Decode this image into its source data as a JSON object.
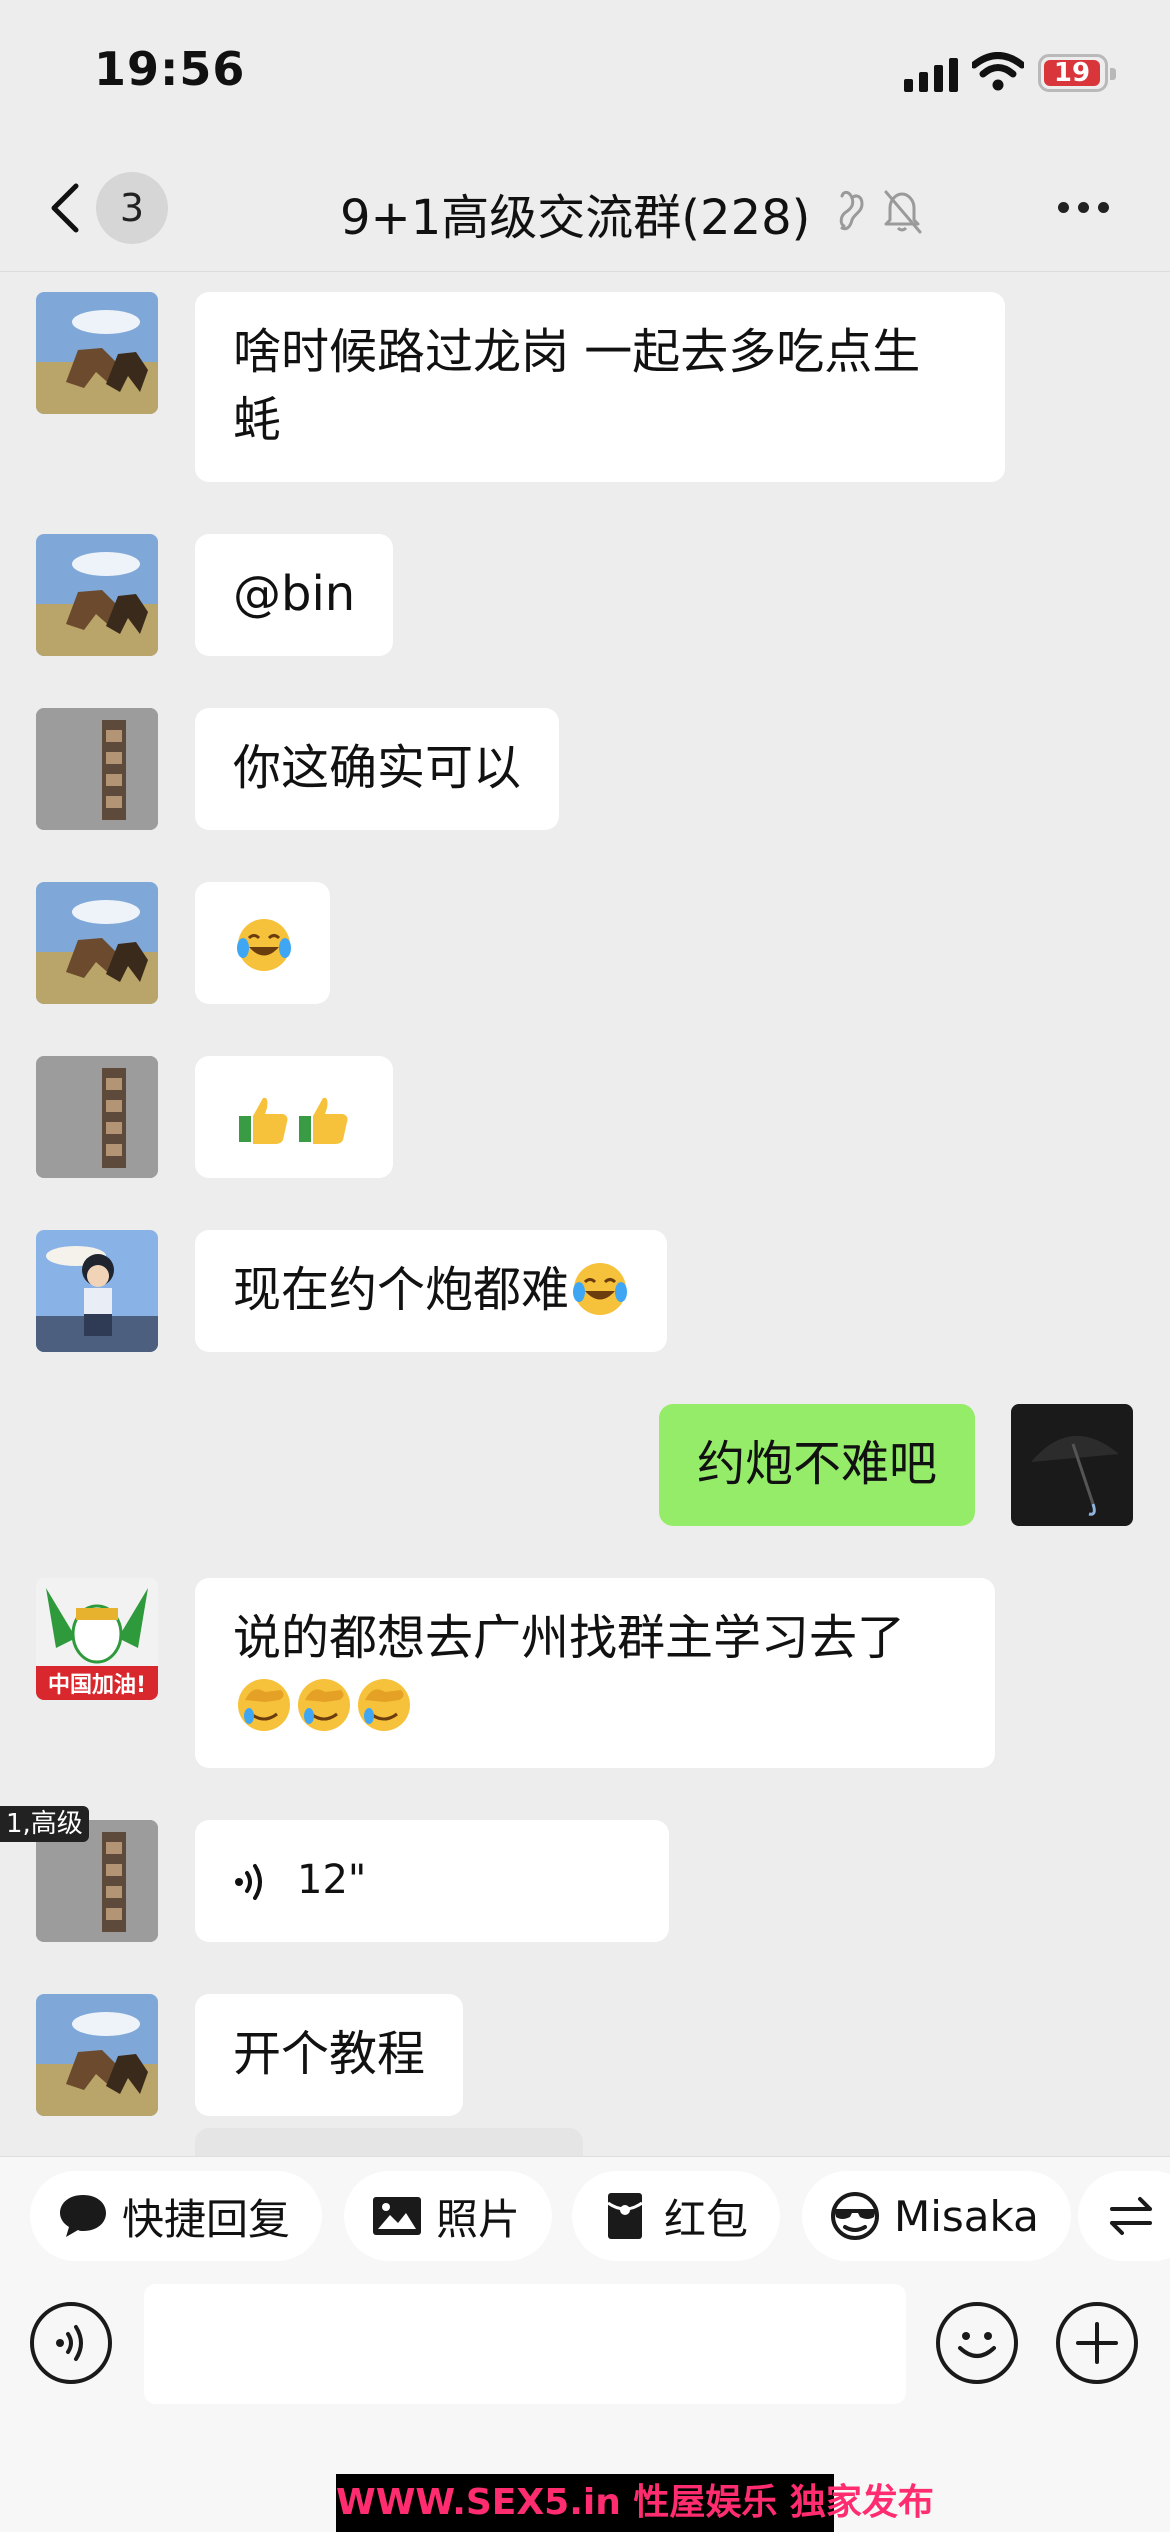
{
  "status_bar": {
    "time": "19:56",
    "battery": "19"
  },
  "nav": {
    "unread_count": "3",
    "title": "9+1高级交流群(228)"
  },
  "messages": [
    {
      "side": "left",
      "avatar": "horses-avatar",
      "text": "啥时候路过龙岗 一起去多吃点生蚝"
    },
    {
      "side": "left",
      "avatar": "horses-avatar",
      "text": "@bin"
    },
    {
      "side": "left",
      "avatar": "wall-avatar",
      "text": "你这确实可以"
    },
    {
      "side": "left",
      "avatar": "horses-avatar",
      "emojis": [
        "tears-of-joy"
      ]
    },
    {
      "side": "left",
      "avatar": "wall-avatar",
      "emojis": [
        "thumbs-up",
        "thumbs-up"
      ]
    },
    {
      "side": "left",
      "avatar": "anime-boy-avatar",
      "text": "现在约个炮都难",
      "emojis": [
        "tears-of-joy"
      ]
    },
    {
      "side": "right",
      "avatar": "umbrella-avatar",
      "text": "约炮不难吧"
    },
    {
      "side": "left",
      "avatar": "china-jiayou-avatar",
      "text": "说的都想去广州找群主学习去了",
      "emojis": [
        "facepalm",
        "facepalm",
        "facepalm"
      ]
    },
    {
      "side": "left",
      "avatar": "wall-avatar",
      "voice_duration": "12\"",
      "member_tag": "1,高级"
    },
    {
      "side": "left",
      "avatar": "horses-avatar",
      "text": "开个教程"
    }
  ],
  "avatar_labels": {
    "china_jiayou": "中国加油!"
  },
  "quick_actions": [
    {
      "icon": "speech-bubble-icon",
      "label": "快捷回复"
    },
    {
      "icon": "photo-icon",
      "label": "照片"
    },
    {
      "icon": "red-packet-icon",
      "label": "红包"
    },
    {
      "icon": "sunglasses-face-icon",
      "label": "Misaka"
    }
  ],
  "watermark": "WWW.SEX5.in 性屋娱乐 独家发布",
  "colors": {
    "background": "#ededed",
    "own_bubble": "#95ec69",
    "other_bubble": "#ffffff",
    "battery_low": "#d8363a"
  }
}
